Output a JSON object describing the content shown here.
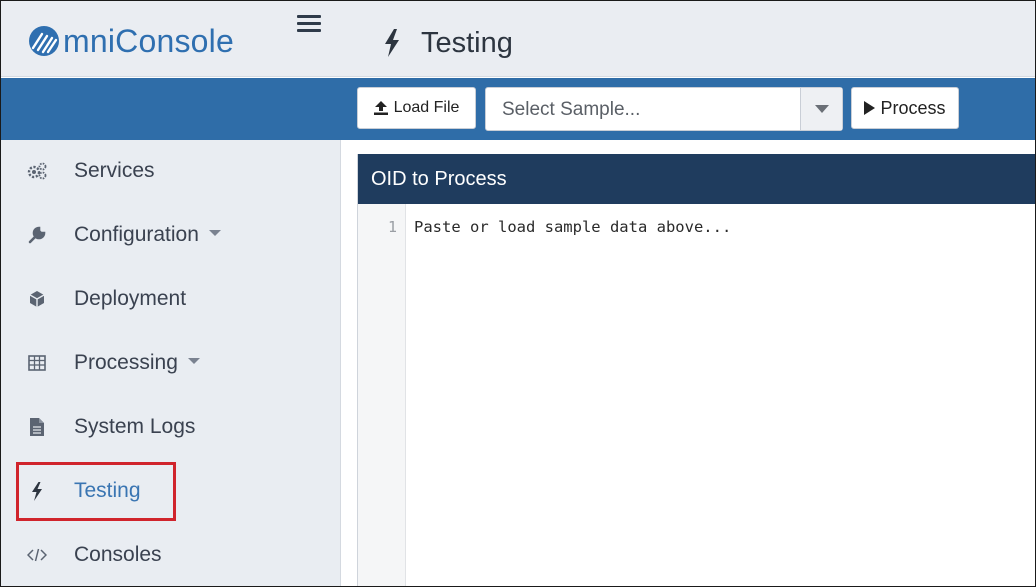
{
  "app": {
    "brand": "mniConsole",
    "page_title": "Testing"
  },
  "toolbar": {
    "load_file_label": "Load File",
    "sample_select_placeholder": "Select Sample...",
    "process_label": "Process"
  },
  "sidebar": {
    "items": [
      {
        "label": "Services",
        "icon": "cogs-icon",
        "has_caret": false
      },
      {
        "label": "Configuration",
        "icon": "wrench-icon",
        "has_caret": true
      },
      {
        "label": "Deployment",
        "icon": "cube-icon",
        "has_caret": false
      },
      {
        "label": "Processing",
        "icon": "table-icon",
        "has_caret": true
      },
      {
        "label": "System Logs",
        "icon": "file-icon",
        "has_caret": false
      },
      {
        "label": "Testing",
        "icon": "bolt-icon",
        "has_caret": false,
        "active": true
      },
      {
        "label": "Consoles",
        "icon": "code-icon",
        "has_caret": false
      }
    ]
  },
  "panel": {
    "header": "OID to Process",
    "editor": {
      "line_number": "1",
      "placeholder_line": "Paste or load sample data above..."
    }
  },
  "colors": {
    "brand_blue": "#2f6fb0",
    "toolbar_blue": "#2f6da8",
    "panel_header": "#1f3c5e",
    "sidebar_bg": "#e9edf2",
    "highlight_red": "#d0242c"
  }
}
